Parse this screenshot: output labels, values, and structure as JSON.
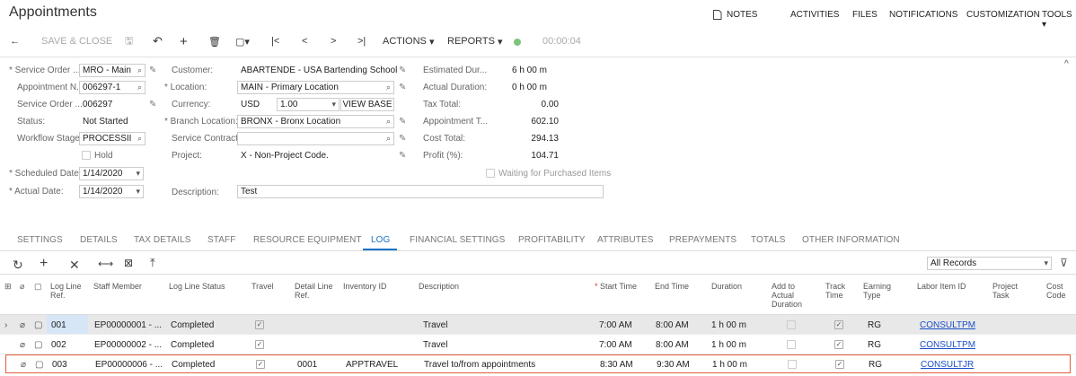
{
  "title": "Appointments",
  "topnav": [
    "NOTES",
    "ACTIVITIES",
    "FILES",
    "NOTIFICATIONS",
    "CUSTOMIZATION",
    "TOOLS"
  ],
  "toolbar": {
    "save_close": "SAVE & CLOSE",
    "actions": "ACTIONS",
    "reports": "REPORTS",
    "timer": "00:00:04"
  },
  "form": {
    "service_order_type": {
      "label": "Service Order ...",
      "value": "MRO - Main"
    },
    "appointment_nbr": {
      "label": "Appointment N...",
      "value": "006297-1"
    },
    "service_order_nbr": {
      "label": "Service Order ...",
      "value": "006297"
    },
    "status": {
      "label": "Status:",
      "value": "Not Started"
    },
    "workflow_stage": {
      "label": "Workflow Stage:",
      "value": "PROCESSII"
    },
    "hold": {
      "label": "Hold"
    },
    "scheduled_date": {
      "label": "Scheduled Date:",
      "value": "1/14/2020"
    },
    "actual_date": {
      "label": "Actual Date:",
      "value": "1/14/2020"
    },
    "customer": {
      "label": "Customer:",
      "value": "ABARTENDE - USA Bartending School"
    },
    "location": {
      "label": "Location:",
      "value": "MAIN - Primary Location"
    },
    "currency": {
      "label": "Currency:",
      "value": "USD",
      "rate": "1.00",
      "view_base": "VIEW BASE"
    },
    "branch_location": {
      "label": "Branch Location:",
      "value": "BRONX - Bronx Location"
    },
    "service_contract": {
      "label": "Service Contract:",
      "value": ""
    },
    "project": {
      "label": "Project:",
      "value": "X - Non-Project Code."
    },
    "description": {
      "label": "Description:",
      "value": "Test"
    },
    "estimated_duration": {
      "label": "Estimated Dur...",
      "value": "6 h 00 m"
    },
    "actual_duration": {
      "label": "Actual Duration:",
      "value": "0 h 00 m"
    },
    "tax_total": {
      "label": "Tax Total:",
      "value": "0.00"
    },
    "appointment_total": {
      "label": "Appointment T...",
      "value": "602.10"
    },
    "cost_total": {
      "label": "Cost Total:",
      "value": "294.13"
    },
    "profit": {
      "label": "Profit (%):",
      "value": "104.71"
    },
    "waiting": {
      "label": "Waiting for Purchased Items"
    }
  },
  "tabs": [
    "SETTINGS",
    "DETAILS",
    "TAX DETAILS",
    "STAFF",
    "RESOURCE EQUIPMENT",
    "LOG",
    "FINANCIAL SETTINGS",
    "PROFITABILITY",
    "ATTRIBUTES",
    "PREPAYMENTS",
    "TOTALS",
    "OTHER INFORMATION"
  ],
  "grid_filter": "All Records",
  "columns": {
    "log_line_ref": "Log Line Ref.",
    "staff_member": "Staff Member",
    "log_line_status": "Log Line Status",
    "travel": "Travel",
    "detail_line_ref": "Detail Line Ref.",
    "inventory_id": "Inventory ID",
    "description": "Description",
    "start_time": "Start Time",
    "end_time": "End Time",
    "duration": "Duration",
    "add_to_actual": "Add to Actual Duration",
    "track_time": "Track Time",
    "earning_type": "Earning Type",
    "labor_item_id": "Labor Item ID",
    "project_task": "Project Task",
    "cost_code": "Cost Code"
  },
  "rows": [
    {
      "ref": "001",
      "staff": "EP00000001 - ...",
      "status": "Completed",
      "travel": true,
      "detail_ref": "",
      "inventory": "",
      "description": "Travel",
      "start": "7:00 AM",
      "end": "8:00 AM",
      "duration": "1 h 00 m",
      "add_actual": false,
      "track": true,
      "earning": "RG",
      "labor": "CONSULTPM"
    },
    {
      "ref": "002",
      "staff": "EP00000002 - ...",
      "status": "Completed",
      "travel": true,
      "detail_ref": "",
      "inventory": "",
      "description": "Travel",
      "start": "7:00 AM",
      "end": "8:00 AM",
      "duration": "1 h 00 m",
      "add_actual": false,
      "track": true,
      "earning": "RG",
      "labor": "CONSULTPM"
    },
    {
      "ref": "003",
      "staff": "EP00000006 - ...",
      "status": "Completed",
      "travel": true,
      "detail_ref": "0001",
      "inventory": "APPTRAVEL",
      "description": "Travel to/from appointments",
      "start": "8:30 AM",
      "end": "9:30 AM",
      "duration": "1 h 00 m",
      "add_actual": false,
      "track": true,
      "earning": "RG",
      "labor": "CONSULTJR"
    }
  ],
  "colors": {
    "accent": "#1a73c9",
    "link": "#1a4ec9",
    "highlight_row": "#e8e8e8",
    "selected_border": "#e05c3b",
    "timer_ok": "#7cc47c"
  }
}
